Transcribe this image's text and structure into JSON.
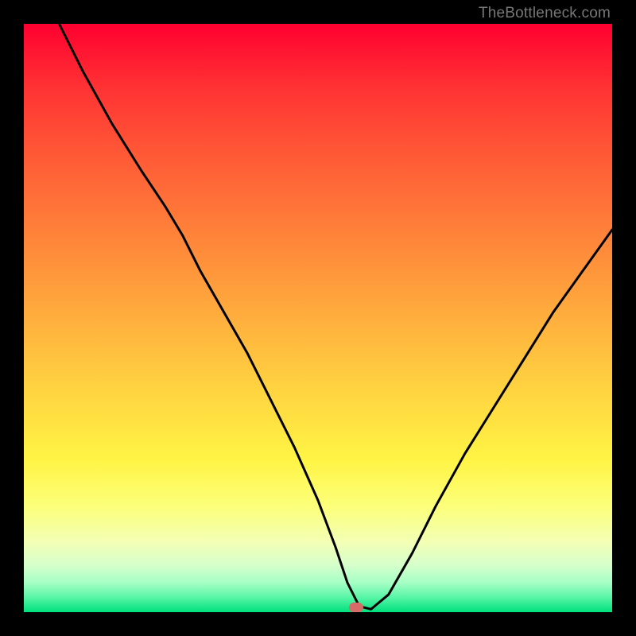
{
  "watermark": "TheBottleneck.com",
  "marker": {
    "color": "#d86b67",
    "x_pct": 56.5,
    "y_pct": 99.2
  },
  "chart_data": {
    "type": "line",
    "title": "",
    "xlabel": "",
    "ylabel": "",
    "xlim": [
      0,
      100
    ],
    "ylim": [
      0,
      100
    ],
    "grid": false,
    "legend": false,
    "series": [
      {
        "name": "bottleneck-curve",
        "x": [
          6,
          10,
          15,
          20,
          24,
          27,
          30,
          34,
          38,
          42,
          46,
          50,
          53,
          55,
          57,
          59,
          62,
          66,
          70,
          75,
          80,
          85,
          90,
          95,
          100
        ],
        "y": [
          100,
          92,
          83,
          75,
          69,
          64,
          58,
          51,
          44,
          36,
          28,
          19,
          11,
          5,
          1,
          0.5,
          3,
          10,
          18,
          27,
          35,
          43,
          51,
          58,
          65
        ]
      }
    ],
    "annotations": [
      {
        "type": "marker",
        "shape": "pill",
        "color": "#d86b67",
        "x": 56.5,
        "y": 0.8
      }
    ],
    "background_gradient_stops": [
      {
        "pos": 0,
        "color": "#ff0030"
      },
      {
        "pos": 0.1,
        "color": "#ff2f33"
      },
      {
        "pos": 0.22,
        "color": "#ff5836"
      },
      {
        "pos": 0.35,
        "color": "#ff8039"
      },
      {
        "pos": 0.48,
        "color": "#ffa83d"
      },
      {
        "pos": 0.61,
        "color": "#ffd040"
      },
      {
        "pos": 0.74,
        "color": "#fff444"
      },
      {
        "pos": 0.82,
        "color": "#fcff7a"
      },
      {
        "pos": 0.88,
        "color": "#f3ffb4"
      },
      {
        "pos": 0.92,
        "color": "#d6ffcb"
      },
      {
        "pos": 0.95,
        "color": "#a6ffc5"
      },
      {
        "pos": 0.975,
        "color": "#58f5a6"
      },
      {
        "pos": 1.0,
        "color": "#00e07c"
      }
    ]
  }
}
